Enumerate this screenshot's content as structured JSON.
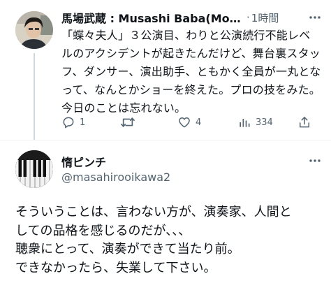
{
  "tweet": {
    "display_name": "馬場武蔵 : Musashi Baba(Μουσ...",
    "separator": "·",
    "time": "1時間",
    "text": "「蝶々夫人」３公演目、わりと公演続行不能レベルのアクシデントが起きたんだけど、舞台裏スタッフ、ダンサー、演出助手、ともかく全員が一丸となって、なんとかショーを終えた。プロの技をみた。今日のことは忘れない。",
    "more_icon": "more-horizontal-icon",
    "actions": {
      "reply_count": "1",
      "retweet_count": "",
      "like_count": "4",
      "view_count": "334"
    }
  },
  "quote": {
    "display_name": "惰ピンチ",
    "handle": "@masahirooikawa2",
    "more_icon": "more-horizontal-icon",
    "lines": [
      "そういうことは、言わない方が、演奏家、人間と",
      "しての品格を感じるのだが、、、",
      "聴衆にとって、演奏ができて当たり前。",
      "できなかったら、失業して下さい。"
    ]
  },
  "colors": {
    "text": "#0f1419",
    "secondary": "#536471",
    "divider": "#eff3f4"
  }
}
